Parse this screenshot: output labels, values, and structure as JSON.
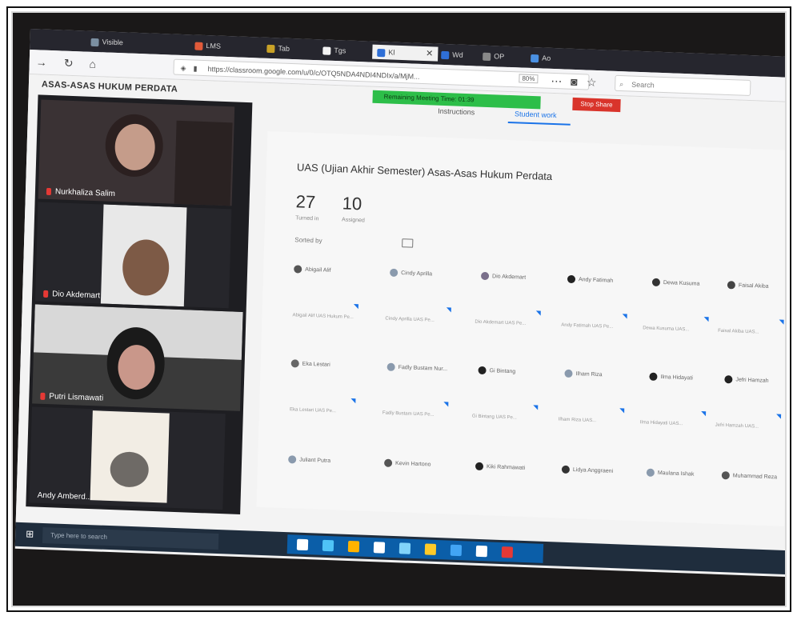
{
  "browser": {
    "tabs": [
      {
        "label": "Visible",
        "color": "#7b8fa1"
      },
      {
        "label": "LMS",
        "color": "#e05a3a"
      },
      {
        "label": "Tab",
        "color": "#c9a227"
      },
      {
        "label": "Tgs",
        "color": "#f2f2f2"
      },
      {
        "label": "Kl",
        "color": "#2f6fd6",
        "active": true
      },
      {
        "label": "Wd",
        "color": "#2f6fd6"
      },
      {
        "label": "OP",
        "color": "#888888"
      },
      {
        "label": "Ao",
        "color": "#4a90e2"
      }
    ],
    "url": "https://classroom.google.com/u/0/c/OTQ5NDA4NDI4NDIx/a/MjM...",
    "zoom": "80%",
    "search_placeholder": "Search"
  },
  "page": {
    "course_title": "ASAS-ASAS HUKUM PERDATA",
    "meeting_bar": "Remaining Meeting Time: 01:39",
    "stop_share": "Stop Share",
    "subtabs": [
      "Instructions",
      "Student work"
    ]
  },
  "participants": [
    {
      "name": "Nurkhaliza Salim",
      "bg": "#3a3234"
    },
    {
      "name": "Dio Akdemart",
      "bg": "#26262b"
    },
    {
      "name": "Putri Lismawati",
      "bg": "#3a3a3a"
    },
    {
      "name": "Andy Amberd...",
      "bg": "#26262b"
    }
  ],
  "assignment": {
    "title": "UAS (Ujian Akhir Semester) Asas-Asas Hukum Perdata",
    "turned_in": "27",
    "turned_in_label": "Turned in",
    "assigned": "10",
    "assigned_label": "Assigned",
    "sort_label": "Sorted by"
  },
  "students_row1": [
    "Abigail Alif",
    "Cindy Aprilla",
    "Dio Akdemart",
    "Andy Fatimah",
    "Dewa Kusuma",
    "Faisal Akiba"
  ],
  "docs_row1": [
    "Abigail Alif UAS Hukum Pe...",
    "Cindy Aprilla UAS Pe...",
    "Dio Akdemart UAS Pe...",
    "Andy Fatimah UAS Pe...",
    "Dewa Kusuma UAS...",
    "Faisal Akiba UAS..."
  ],
  "students_row2": [
    "Eka Lestari",
    "Fadly Bustam Nur...",
    "Gi Bintang",
    "Ilham Riza",
    "Ilma Hidayati",
    "Jefri Hamzah"
  ],
  "docs_row2": [
    "Eka Lestari UAS Pe...",
    "Fadly Bustam UAS Pe...",
    "Gi Bintang UAS Pe...",
    "Ilham Riza UAS...",
    "Ilma Hidayati UAS...",
    "Jefri Hamzah UAS..."
  ],
  "students_row3": [
    "Juliant Putra",
    "Kevin Hartono",
    "Kiki Rahmawati",
    "Lidya Anggraeni",
    "Maulana Ishak",
    "Muhammad Reza"
  ],
  "taskbar": {
    "search": "Type here to search",
    "icon_colors": [
      "#ffffff",
      "#4fc3f7",
      "#ffb300",
      "#ffffff",
      "#81d4fa",
      "#ffca28",
      "#42a5f5",
      "#ffffff",
      "#e53935"
    ]
  }
}
